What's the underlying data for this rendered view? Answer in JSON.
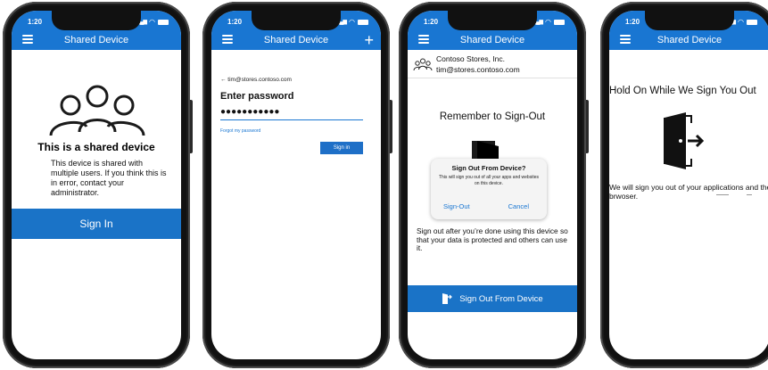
{
  "colors": {
    "primary": "#1976d2",
    "button": "#1a73c7",
    "text": "#111111",
    "background": "#ffffff"
  },
  "status": {
    "time": "1:20"
  },
  "phone1": {
    "app_title": "Shared Device",
    "title": "This is a shared device",
    "message": "This device is shared with multiple users. If you think this is in error, contact your administrator.",
    "button": "Sign In"
  },
  "phone2": {
    "app_title": "Shared Device",
    "back_email": "← tim@stores.contoso.com",
    "heading": "Enter password",
    "password_value": "●●●●●●●●●●●",
    "forgot_link": "Forgot my password",
    "button": "Sign in"
  },
  "phone3": {
    "app_title": "Shared Device",
    "org_name": "Contoso Stores, Inc.",
    "email": "tim@stores.contoso.com",
    "heading": "Remember to Sign-Out",
    "dialog": {
      "title": "Sign Out From Device?",
      "message": "This will sign you out of all your apps and websites on this device.",
      "confirm": "Sign-Out",
      "cancel": "Cancel"
    },
    "message": "Sign out after you’re done using this device so that your data is protected and others can use it.",
    "button": "Sign Out From Device"
  },
  "phone4": {
    "app_title": "Shared Device",
    "heading": "Hold On While We Sign You Out",
    "message": "We will sign you out of your applications and the brwoser."
  },
  "icons": [
    "menu-icon",
    "plus-icon",
    "users-icon",
    "account-icon",
    "sign-out-door-icon",
    "wifi-icon",
    "battery-icon",
    "signal-icon",
    "location-arrow-icon"
  ]
}
